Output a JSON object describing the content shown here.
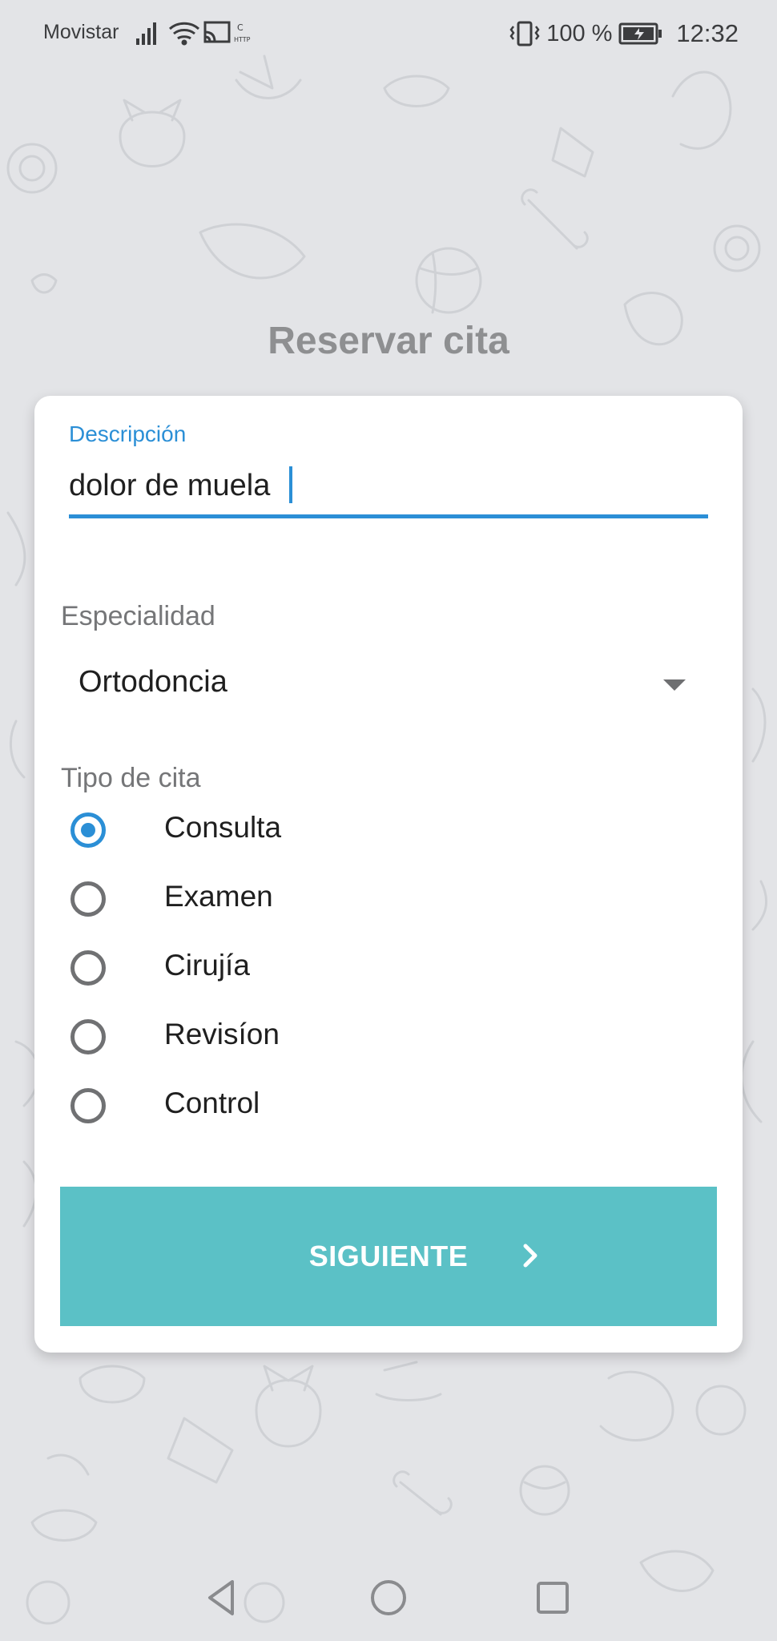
{
  "status_bar": {
    "carrier": "Movistar",
    "battery": "100 %",
    "time": "12:32",
    "icons": [
      "signal-icon",
      "wifi-icon",
      "cast-icon",
      "http-icon",
      "vibrate-icon",
      "battery-charging-icon"
    ]
  },
  "page": {
    "title": "Reservar cita"
  },
  "form": {
    "description": {
      "label": "Descripción",
      "value": "dolor de muela"
    },
    "specialty": {
      "label": "Especialidad",
      "selected": "Ortodoncia"
    },
    "appointment_type": {
      "label": "Tipo de cita",
      "options": [
        {
          "label": "Consulta",
          "checked": true
        },
        {
          "label": "Examen",
          "checked": false
        },
        {
          "label": "Cirujía",
          "checked": false
        },
        {
          "label": "Revisíon",
          "checked": false
        },
        {
          "label": "Control",
          "checked": false
        }
      ]
    },
    "next_button": {
      "label": "SIGUIENTE"
    }
  },
  "navigation": {
    "buttons": [
      "back-icon",
      "home-icon",
      "recents-icon"
    ]
  },
  "colors": {
    "accent": "#2b8fd6",
    "button": "#5bc1c6",
    "background": "#e3e4e7",
    "title": "#8e8f91"
  }
}
